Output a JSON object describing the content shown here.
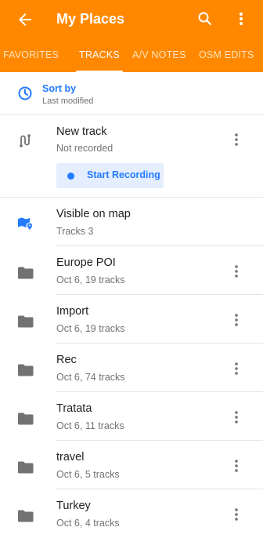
{
  "appbar": {
    "title": "My Places",
    "back_icon": "arrow-left-icon",
    "search_icon": "search-icon",
    "menu_icon": "more-vert-icon",
    "background": "#ff8800"
  },
  "tabs": [
    {
      "label": "FAVORITES",
      "active": false
    },
    {
      "label": "TRACKS",
      "active": true
    },
    {
      "label": "A/V NOTES",
      "active": false
    },
    {
      "label": "OSM EDITS",
      "active": false
    }
  ],
  "sort": {
    "title": "Sort by",
    "value": "Last modified",
    "icon": "clock-icon"
  },
  "new_track": {
    "title": "New track",
    "status": "Not recorded",
    "button_label": "Start Recording",
    "icon": "route-icon",
    "accent": "#237bff"
  },
  "visible_on_map": {
    "title": "Visible on map",
    "subtitle": "Tracks 3",
    "icon": "map-icon"
  },
  "folders": [
    {
      "name": "Europe POI",
      "meta": "Oct 6, 19 tracks"
    },
    {
      "name": "Import",
      "meta": "Oct 6, 19 tracks"
    },
    {
      "name": "Rec",
      "meta": "Oct 6, 74 tracks"
    },
    {
      "name": "Tratata",
      "meta": "Oct 6, 11 tracks"
    },
    {
      "name": "travel",
      "meta": "Oct 6, 5 tracks"
    },
    {
      "name": "Turkey",
      "meta": "Oct 6, 4 tracks"
    }
  ]
}
